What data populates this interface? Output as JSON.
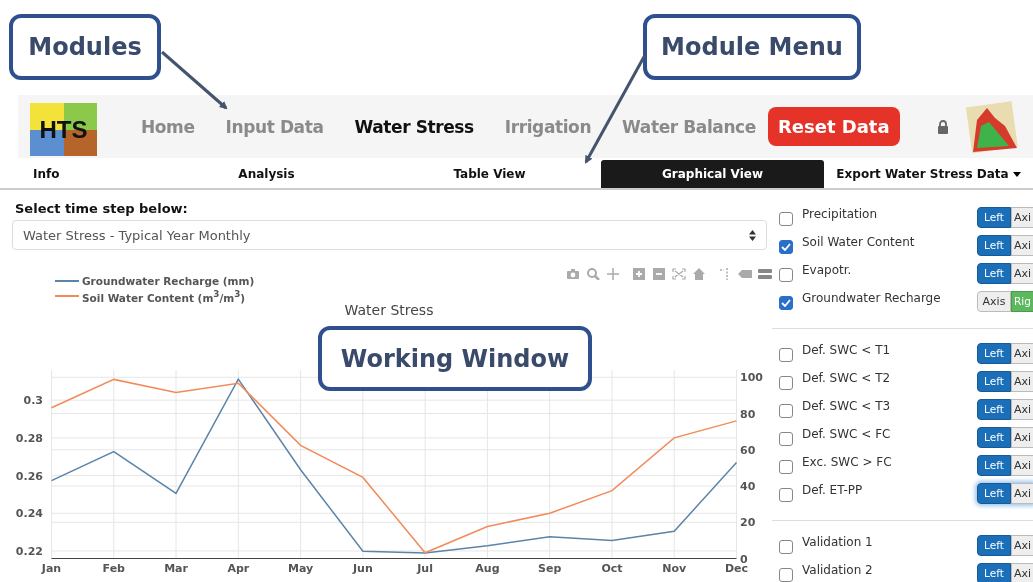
{
  "callouts": [
    {
      "label": "Modules"
    },
    {
      "label": "Module Menu"
    },
    {
      "label": "Working Window"
    }
  ],
  "nav": {
    "logo": "HTS",
    "items": [
      {
        "label": "Home",
        "selected": false
      },
      {
        "label": "Input Data",
        "selected": false
      },
      {
        "label": "Water Stress",
        "selected": true
      },
      {
        "label": "Irrigation",
        "selected": false
      },
      {
        "label": "Water Balance",
        "selected": false
      }
    ],
    "reset_button": "Reset Data"
  },
  "tabs": [
    {
      "label": "Info",
      "kind": "tab",
      "selected": false
    },
    {
      "label": "Analysis",
      "kind": "tab",
      "selected": false
    },
    {
      "label": "Table View",
      "kind": "tab",
      "selected": false
    },
    {
      "label": "Graphical View",
      "kind": "tab",
      "selected": true
    },
    {
      "label": "Export Water Stress Data",
      "kind": "dropdown",
      "selected": false
    }
  ],
  "time_step": {
    "label": "Select time step below:",
    "value": "Water Stress - Typical Year Monthly"
  },
  "chart": {
    "chart_data": {
      "type": "line",
      "title": "Water Stress",
      "grid": true,
      "legend": "top-left",
      "categories": [
        "Jan",
        "Feb",
        "Mar",
        "Apr",
        "May",
        "Jun",
        "Jul",
        "Aug",
        "Sep",
        "Oct",
        "Nov",
        "Dec"
      ],
      "series": [
        {
          "name": "Groundwater Recharge (mm)",
          "color": "#5b84a8",
          "axis": "y2",
          "values": [
            43,
            59,
            36,
            99,
            49,
            4,
            3,
            7,
            12,
            10,
            15,
            53
          ]
        },
        {
          "name": "Soil Water Content (m$^{3}$/m$^{3}$)",
          "color": "#f28a5a",
          "values": [
            0.296,
            0.311,
            0.304,
            0.309,
            0.276,
            0.259,
            0.219,
            0.233,
            0.24,
            0.252,
            0.28,
            0.289
          ]
        }
      ],
      "ylim": [
        0.216,
        0.316
      ],
      "yticks": [
        {
          "value": 0.22,
          "label": "0.22"
        },
        {
          "value": 0.24,
          "label": "0.24"
        },
        {
          "value": 0.26,
          "label": "0.26"
        },
        {
          "value": 0.28,
          "label": "0.28"
        },
        {
          "value": 0.3,
          "label": "0.3"
        }
      ],
      "y2lim": [
        0,
        104
      ],
      "y2ticks": [
        0,
        20,
        40,
        60,
        80,
        100
      ]
    }
  },
  "series_panel": {
    "groups": [
      {
        "rows": [
          {
            "label": "Precipitation",
            "checked": false,
            "focused": false,
            "buttons": [
              {
                "label": "Left",
                "kind": "left",
                "selected": true
              },
              {
                "label": "Axi",
                "kind": "axis",
                "selected": false
              }
            ]
          },
          {
            "label": "Soil Water Content",
            "checked": true,
            "focused": false,
            "buttons": [
              {
                "label": "Left",
                "kind": "left",
                "selected": true
              },
              {
                "label": "Axi",
                "kind": "axis",
                "selected": false
              }
            ]
          },
          {
            "label": "Evapotr.",
            "checked": false,
            "focused": false,
            "buttons": [
              {
                "label": "Left",
                "kind": "left",
                "selected": true
              },
              {
                "label": "Axi",
                "kind": "axis",
                "selected": false
              }
            ]
          },
          {
            "label": "Groundwater Recharge",
            "checked": true,
            "focused": false,
            "buttons": [
              {
                "label": "Axis",
                "kind": "axis",
                "selected": false
              },
              {
                "label": "Rig",
                "kind": "right",
                "selected": true
              }
            ]
          }
        ]
      },
      {
        "rows": [
          {
            "label": "Def. SWC < T1",
            "checked": false,
            "focused": false,
            "buttons": [
              {
                "label": "Left",
                "kind": "left",
                "selected": true
              },
              {
                "label": "Axi",
                "kind": "axis",
                "selected": false
              }
            ]
          },
          {
            "label": "Def. SWC < T2",
            "checked": false,
            "focused": false,
            "buttons": [
              {
                "label": "Left",
                "kind": "left",
                "selected": true
              },
              {
                "label": "Axi",
                "kind": "axis",
                "selected": false
              }
            ]
          },
          {
            "label": "Def. SWC < T3",
            "checked": false,
            "focused": false,
            "buttons": [
              {
                "label": "Left",
                "kind": "left",
                "selected": true
              },
              {
                "label": "Axi",
                "kind": "axis",
                "selected": false
              }
            ]
          },
          {
            "label": "Def. SWC < FC",
            "checked": false,
            "focused": false,
            "buttons": [
              {
                "label": "Left",
                "kind": "left",
                "selected": true
              },
              {
                "label": "Axi",
                "kind": "axis",
                "selected": false
              }
            ]
          },
          {
            "label": "Exc. SWC > FC",
            "checked": false,
            "focused": false,
            "buttons": [
              {
                "label": "Left",
                "kind": "left",
                "selected": true
              },
              {
                "label": "Axi",
                "kind": "axis",
                "selected": false
              }
            ]
          },
          {
            "label": "Def. ET-PP",
            "checked": false,
            "focused": true,
            "buttons": [
              {
                "label": "Left",
                "kind": "left",
                "selected": true
              },
              {
                "label": "Axi",
                "kind": "axis",
                "selected": false
              }
            ]
          }
        ]
      },
      {
        "rows": [
          {
            "label": "Validation 1",
            "checked": false,
            "focused": false,
            "buttons": [
              {
                "label": "Left",
                "kind": "left",
                "selected": true
              },
              {
                "label": "Axi",
                "kind": "axis",
                "selected": false
              }
            ]
          },
          {
            "label": "Validation 2",
            "checked": false,
            "focused": false,
            "buttons": [
              {
                "label": "Left",
                "kind": "left",
                "selected": true
              },
              {
                "label": "Axi",
                "kind": "axis",
                "selected": false
              }
            ]
          }
        ]
      }
    ]
  }
}
